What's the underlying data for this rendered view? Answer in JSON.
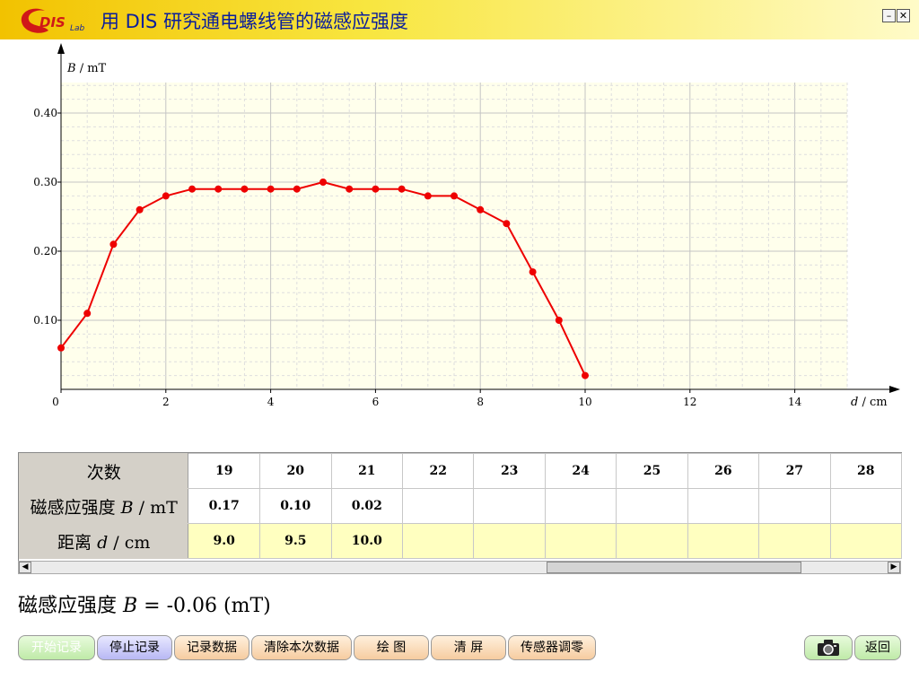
{
  "app": {
    "logo_text": "DISLab",
    "title": "用 DIS 研究通电螺线管的磁感应强度",
    "minimize": "–",
    "close": "✕"
  },
  "chart_data": {
    "type": "line",
    "xlabel_var": "d",
    "xlabel_unit": " / cm",
    "ylabel_var": "B",
    "ylabel_unit": " / mT",
    "xlim": [
      0,
      15
    ],
    "ylim": [
      0,
      0.45
    ],
    "x_ticks": [
      "0",
      "2",
      "4",
      "6",
      "8",
      "10",
      "12",
      "14"
    ],
    "y_ticks": [
      "0.10",
      "0.20",
      "0.30",
      "0.40"
    ],
    "grid": true,
    "color": "#ee0000",
    "x": [
      0,
      0.5,
      1.0,
      1.5,
      2.0,
      2.5,
      3.0,
      3.5,
      4.0,
      4.5,
      5.0,
      5.5,
      6.0,
      6.5,
      7.0,
      7.5,
      8.0,
      8.5,
      9.0,
      9.5,
      10.0
    ],
    "y": [
      0.06,
      0.11,
      0.21,
      0.26,
      0.28,
      0.29,
      0.29,
      0.29,
      0.29,
      0.29,
      0.3,
      0.29,
      0.29,
      0.29,
      0.28,
      0.28,
      0.26,
      0.24,
      0.17,
      0.1,
      0.02
    ]
  },
  "table": {
    "row_headers": [
      "次数",
      "磁感应强度",
      "距离"
    ],
    "b_symbol": "B",
    "b_unit": " / mT",
    "d_symbol": "d",
    "d_unit": " / cm",
    "counts": [
      "19",
      "20",
      "21",
      "22",
      "23",
      "24",
      "25",
      "26",
      "27",
      "28"
    ],
    "b_values": [
      "0.17",
      "0.10",
      "0.02",
      "",
      "",
      "",
      "",
      "",
      "",
      ""
    ],
    "d_values": [
      "9.0",
      "9.5",
      "10.0",
      "",
      "",
      "",
      "",
      "",
      "",
      ""
    ]
  },
  "scrollbar": {
    "left": "◀",
    "right": "▶"
  },
  "readout": {
    "label": "磁感应强度",
    "symbol": "B",
    "equals": " = ",
    "value": "-0.06",
    "unit": " (mT)"
  },
  "buttons": {
    "start": "开始记录",
    "stop": "停止记录",
    "record": "记录数据",
    "clear_current": "清除本次数据",
    "draw": "绘  图",
    "clear_screen": "清  屏",
    "zero": "传感器调零",
    "back": "返回"
  }
}
